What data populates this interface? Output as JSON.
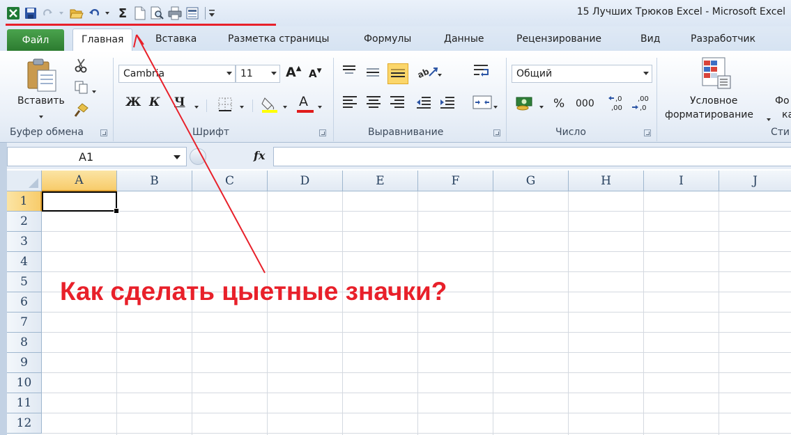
{
  "window": {
    "title": "15 Лучших Трюков Excel  -  Microsoft Excel"
  },
  "quick_access": {
    "icons": [
      "excel-logo-icon",
      "save-icon",
      "redo-icon",
      "open-folder-icon",
      "undo-icon",
      "sum-icon",
      "new-document-icon",
      "print-preview-icon",
      "print-icon",
      "form-icon",
      "customize-qat-icon"
    ],
    "sum_glyph": "Σ"
  },
  "tabs": {
    "file": "Файл",
    "items": [
      "Главная",
      "Вставка",
      "Разметка страницы",
      "Формулы",
      "Данные",
      "Рецензирование",
      "Вид",
      "Разработчик"
    ],
    "active": "Главная"
  },
  "ribbon": {
    "clipboard": {
      "paste_label": "Вставить",
      "group_label": "Буфер обмена"
    },
    "font": {
      "font_name": "Cambria",
      "font_size": "11",
      "bold": "Ж",
      "italic": "К",
      "underline": "Ч",
      "grow": "A",
      "shrink": "A",
      "font_color_letter": "A",
      "group_label": "Шрифт"
    },
    "alignment": {
      "group_label": "Выравнивание"
    },
    "number": {
      "format": "Общий",
      "percent": "%",
      "thousands": "000",
      "inc_decimal": "←,0 ,00",
      "dec_decimal": ",00 →,0",
      "group_label": "Число"
    },
    "styles": {
      "conditional_line1": "Условное",
      "conditional_line2": "форматирование",
      "partial_next_line1": "Фо",
      "partial_next_line2": "ка",
      "group_label_partial": "Сти"
    }
  },
  "formula_bar": {
    "name_box": "A1",
    "fx_label": "fx",
    "value": ""
  },
  "sheet": {
    "columns": [
      "A",
      "B",
      "C",
      "D",
      "E",
      "F",
      "G",
      "H",
      "I",
      "J"
    ],
    "rows": [
      "1",
      "2",
      "3",
      "4",
      "5",
      "6",
      "7",
      "8",
      "9",
      "10",
      "11",
      "12"
    ],
    "active_cell": "A1"
  },
  "annotation": {
    "text": "Как сделать цыетные значки?",
    "color": "#e8202a"
  },
  "colors": {
    "file_tab": "#2b7a2f",
    "highlight": "#f8cc6b",
    "annotation": "#e8202a"
  }
}
